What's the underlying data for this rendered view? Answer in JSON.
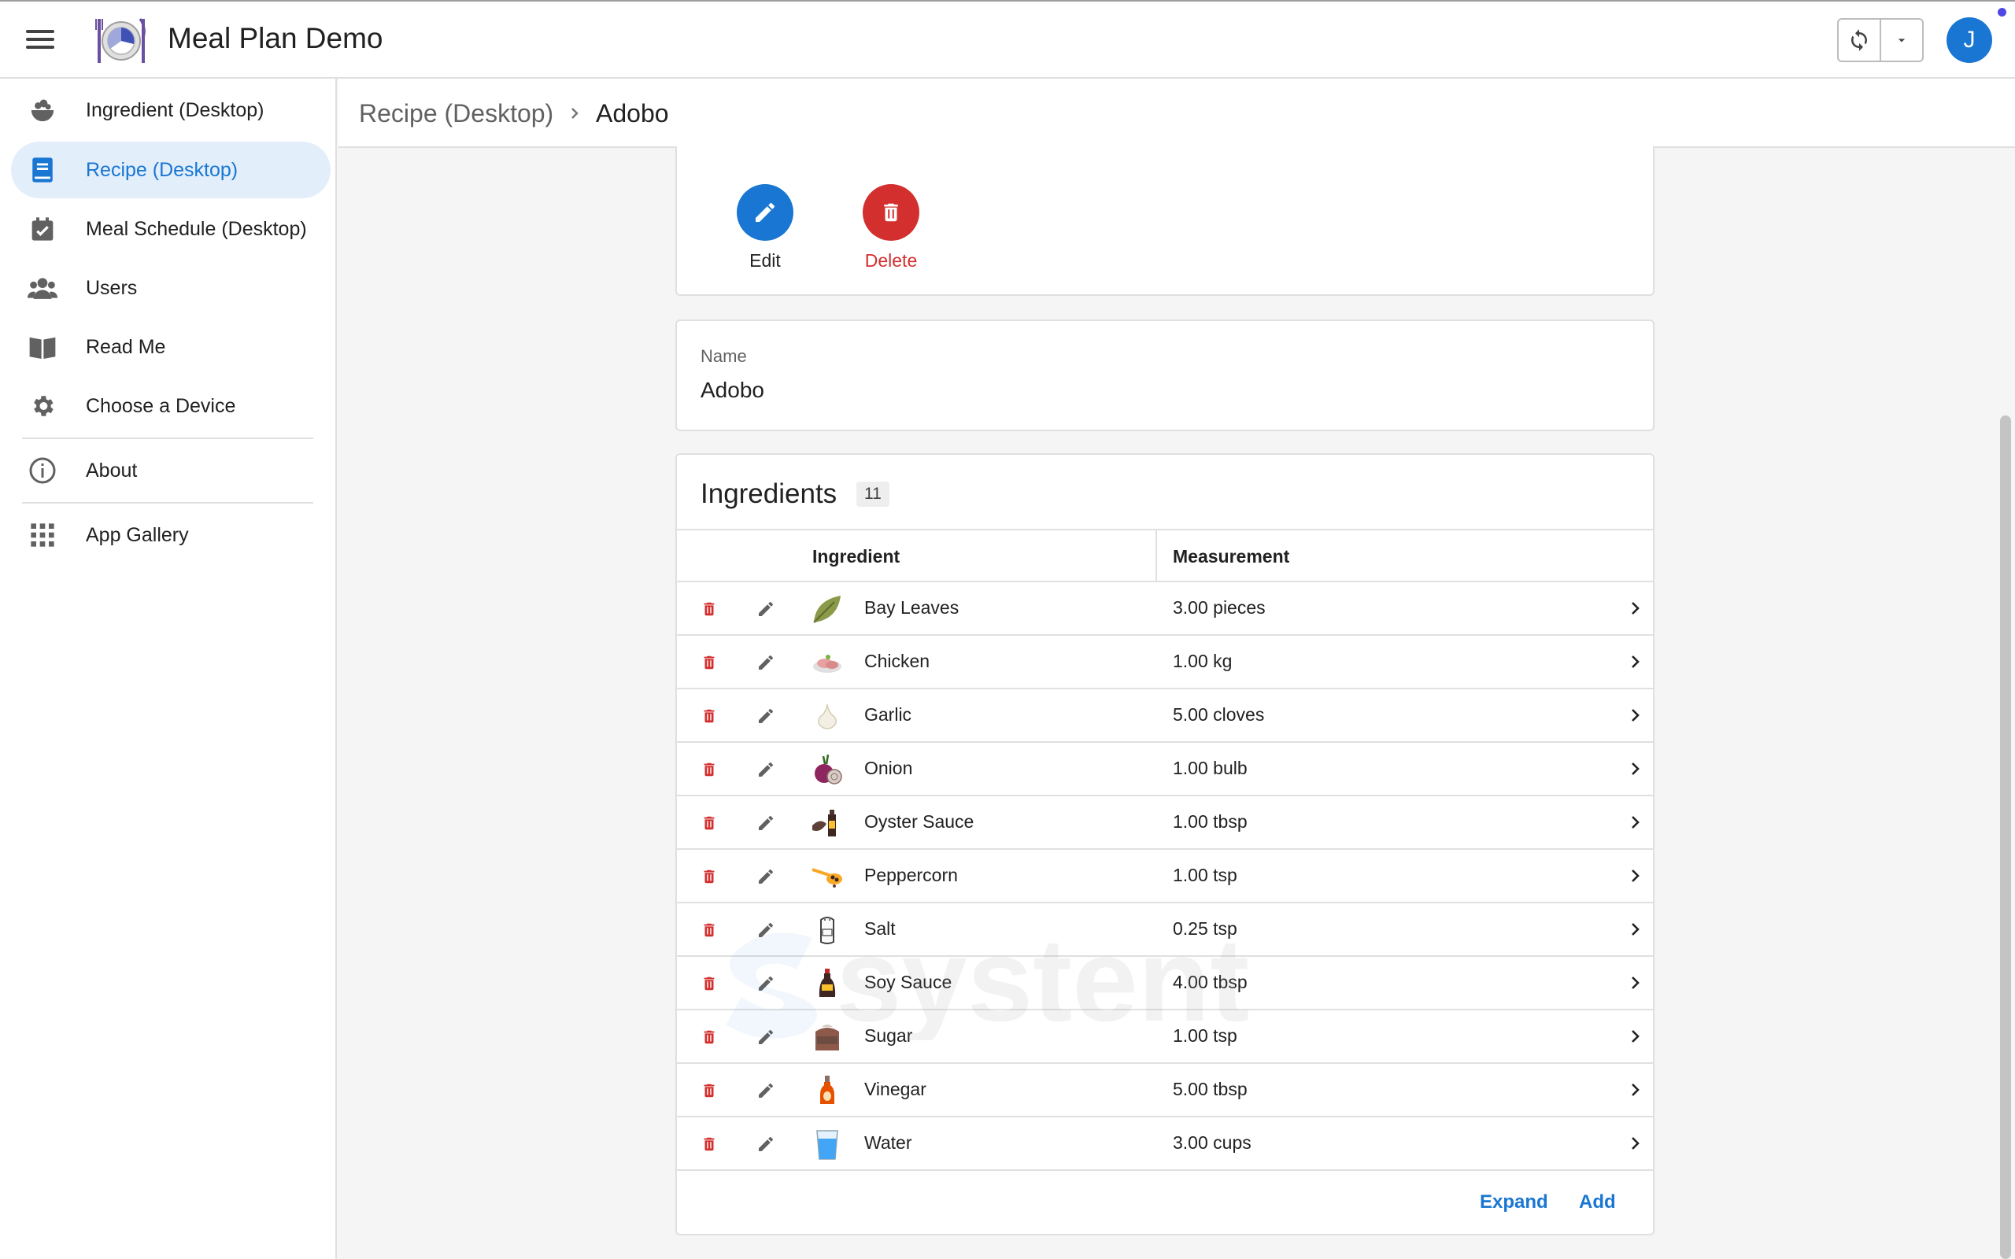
{
  "app": {
    "title": "Meal Plan Demo",
    "avatar_initial": "J"
  },
  "sidebar": {
    "items": [
      {
        "label": "Ingredient (Desktop)",
        "icon": "salad-bowl-icon"
      },
      {
        "label": "Recipe (Desktop)",
        "icon": "book-icon",
        "active": true
      },
      {
        "label": "Meal Schedule (Desktop)",
        "icon": "calendar-check-icon"
      },
      {
        "label": "Users",
        "icon": "users-icon"
      },
      {
        "label": "Read Me",
        "icon": "open-book-icon"
      },
      {
        "label": "Choose a Device",
        "icon": "gear-icon"
      },
      {
        "label": "About",
        "icon": "info-icon"
      },
      {
        "label": "App Gallery",
        "icon": "grid-icon"
      }
    ]
  },
  "breadcrumb": {
    "parent": "Recipe (Desktop)",
    "current": "Adobo"
  },
  "actions": {
    "edit_label": "Edit",
    "delete_label": "Delete"
  },
  "record": {
    "name_label": "Name",
    "name_value": "Adobo"
  },
  "ingredients": {
    "title": "Ingredients",
    "count": "11",
    "columns": {
      "ingredient": "Ingredient",
      "measurement": "Measurement"
    },
    "rows": [
      {
        "name": "Bay Leaves",
        "measurement": "3.00 pieces",
        "icon": "bay-leaf-icon"
      },
      {
        "name": "Chicken",
        "measurement": "1.00 kg",
        "icon": "chicken-icon"
      },
      {
        "name": "Garlic",
        "measurement": "5.00 cloves",
        "icon": "garlic-icon"
      },
      {
        "name": "Onion",
        "measurement": "1.00 bulb",
        "icon": "onion-icon"
      },
      {
        "name": "Oyster Sauce",
        "measurement": "1.00 tbsp",
        "icon": "oyster-sauce-icon"
      },
      {
        "name": "Peppercorn",
        "measurement": "1.00 tsp",
        "icon": "peppercorn-icon"
      },
      {
        "name": "Salt",
        "measurement": "0.25 tsp",
        "icon": "salt-shaker-icon"
      },
      {
        "name": "Soy Sauce",
        "measurement": "4.00 tbsp",
        "icon": "soy-sauce-icon"
      },
      {
        "name": "Sugar",
        "measurement": "1.00 tsp",
        "icon": "sugar-icon"
      },
      {
        "name": "Vinegar",
        "measurement": "5.00 tbsp",
        "icon": "vinegar-icon"
      },
      {
        "name": "Water",
        "measurement": "3.00 cups",
        "icon": "water-glass-icon"
      }
    ],
    "footer": {
      "expand_label": "Expand",
      "add_label": "Add"
    }
  },
  "watermark": {
    "text": "systent"
  },
  "colors": {
    "primary": "#1976d2",
    "danger": "#d32f2f",
    "active_bg": "#e3eefb"
  }
}
